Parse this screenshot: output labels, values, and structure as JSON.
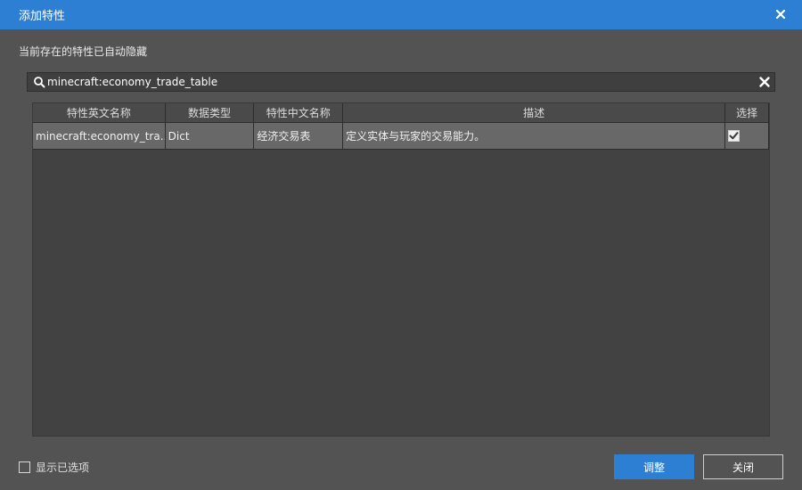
{
  "window": {
    "title": "添加特性"
  },
  "notice": "当前存在的特性已自动隐藏",
  "search": {
    "value": "minecraft:economy_trade_table",
    "placeholder": ""
  },
  "table": {
    "columns": [
      "特性英文名称",
      "数据类型",
      "特性中文名称",
      "描述",
      "选择"
    ],
    "rows": [
      {
        "name_en": "minecraft:economy_tra...",
        "type": "Dict",
        "name_cn": "经济交易表",
        "desc": "定义实体与玩家的交易能力。",
        "selected": true
      }
    ]
  },
  "footer": {
    "show_selected_label": "显示已选项",
    "show_selected_checked": false,
    "confirm_label": "调整",
    "close_label": "关闭"
  },
  "colors": {
    "accent": "#2d7fd3",
    "background": "#535353",
    "grid": "#424242"
  }
}
